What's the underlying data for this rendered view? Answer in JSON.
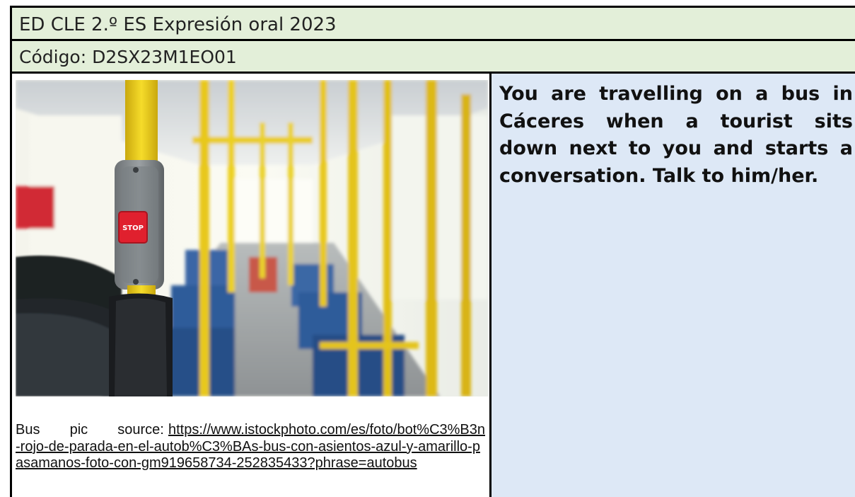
{
  "header": {
    "title": "ED CLE 2.º ES Expresión oral 2023",
    "code": "Código: D2SX23M1EO01"
  },
  "photo": {
    "button_text": "STOP"
  },
  "caption": {
    "lead": "Bus pic source:",
    "url": "https://www.istockphoto.com/es/foto/bot%C3%B3n-rojo-de-parada-en-el-autob%C3%BAs-bus-con-asientos-azul-y-amarillo-pasamanos-foto-con-gm919658734-252835433?phrase=autobus"
  },
  "task": {
    "text": "You are travelling on a bus in Cáceres when a tourist sits down next to you and starts a conversation. Talk to him/her."
  },
  "colors": {
    "header_bg": "#e3efd9",
    "task_bg": "#dde8f6",
    "rail_yellow": "#f0d21c",
    "stop_red": "#e0202e",
    "seat_blue": "#2f5c9a"
  }
}
